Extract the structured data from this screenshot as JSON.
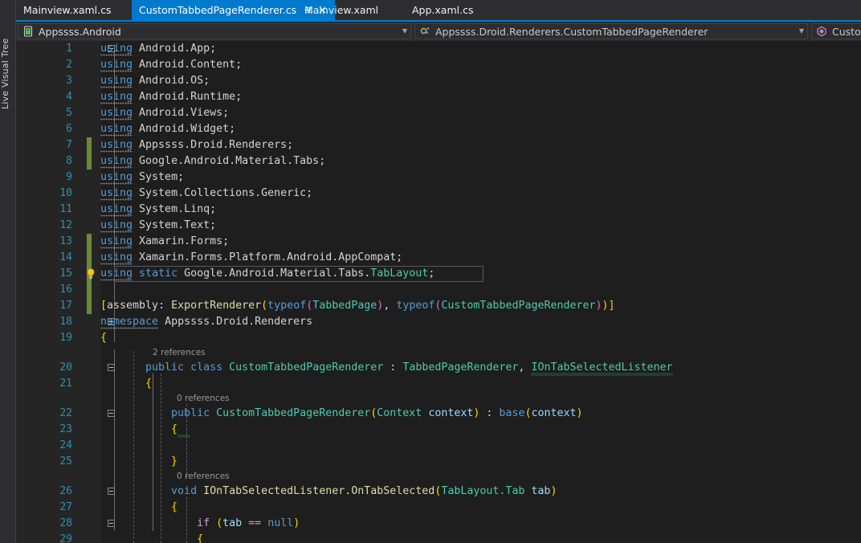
{
  "window": {
    "left_dock_label": "Live Visual Tree"
  },
  "tabs": {
    "items": [
      {
        "label": "Mainview.xaml.cs",
        "active": false
      },
      {
        "label": "CustomTabbedPageRenderer.cs",
        "active": true,
        "pin_icon": "pin-icon",
        "close_icon": "close-icon"
      },
      {
        "label": "Mainview.xaml",
        "active": false
      },
      {
        "label": "App.xaml.cs",
        "active": false
      }
    ],
    "active_bg": "#007acc"
  },
  "navbar": {
    "project": {
      "icon": "android-project-icon",
      "value": "Appssss.Android",
      "dropdown_icon": "chevron-down-icon"
    },
    "type": {
      "icon": "class-icon",
      "value": "Appssss.Droid.Renderers.CustomTabbedPageRenderer",
      "dropdown_icon": "chevron-down-icon"
    },
    "member": {
      "icon": "method-icon",
      "value": "Custom"
    }
  },
  "editor": {
    "language": "csharp",
    "current_line": 15,
    "background": "#1e1e1e",
    "gutter_background": "#252526",
    "linenumber_color": "#2b91af",
    "change_marker_color": "#6a8a3a",
    "change_marker_lines": [
      7,
      8,
      13,
      14,
      15,
      16,
      17
    ],
    "lightbulb_line": 15,
    "codelens": [
      {
        "after_line": 19,
        "text": "2 references"
      },
      {
        "after_line": 21,
        "text": "0 references"
      },
      {
        "after_line": 25,
        "text": "0 references"
      }
    ],
    "lines": [
      {
        "n": 1,
        "text": "using Android.App;"
      },
      {
        "n": 2,
        "text": "using Android.Content;"
      },
      {
        "n": 3,
        "text": "using Android.OS;"
      },
      {
        "n": 4,
        "text": "using Android.Runtime;"
      },
      {
        "n": 5,
        "text": "using Android.Views;"
      },
      {
        "n": 6,
        "text": "using Android.Widget;"
      },
      {
        "n": 7,
        "text": "using Appssss.Droid.Renderers;"
      },
      {
        "n": 8,
        "text": "using Google.Android.Material.Tabs;"
      },
      {
        "n": 9,
        "text": "using System;"
      },
      {
        "n": 10,
        "text": "using System.Collections.Generic;"
      },
      {
        "n": 11,
        "text": "using System.Linq;"
      },
      {
        "n": 12,
        "text": "using System.Text;"
      },
      {
        "n": 13,
        "text": "using Xamarin.Forms;"
      },
      {
        "n": 14,
        "text": "using Xamarin.Forms.Platform.Android.AppCompat;"
      },
      {
        "n": 15,
        "text": "using static Google.Android.Material.Tabs.TabLayout;"
      },
      {
        "n": 16,
        "text": ""
      },
      {
        "n": 17,
        "text": "[assembly: ExportRenderer(typeof(TabbedPage), typeof(CustomTabbedPageRenderer))]"
      },
      {
        "n": 18,
        "text": "namespace Appssss.Droid.Renderers"
      },
      {
        "n": 19,
        "text": "{"
      },
      {
        "n": 20,
        "text": "    public class CustomTabbedPageRenderer : TabbedPageRenderer, IOnTabSelectedListener"
      },
      {
        "n": 21,
        "text": "    {"
      },
      {
        "n": 22,
        "text": "        public CustomTabbedPageRenderer(Context context) : base(context)"
      },
      {
        "n": 23,
        "text": "        {"
      },
      {
        "n": 24,
        "text": ""
      },
      {
        "n": 25,
        "text": "        }"
      },
      {
        "n": 26,
        "text": "        void IOnTabSelectedListener.OnTabSelected(TabLayout.Tab tab)"
      },
      {
        "n": 27,
        "text": "        {"
      },
      {
        "n": 28,
        "text": "            if (tab == null)"
      },
      {
        "n": 29,
        "text": "            {"
      }
    ]
  }
}
